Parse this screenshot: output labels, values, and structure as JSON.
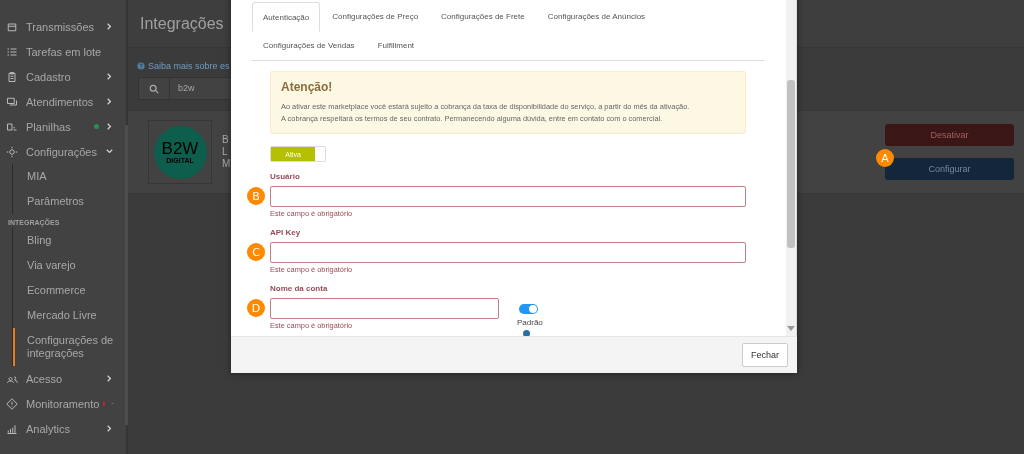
{
  "sidebar": {
    "items": [
      {
        "label": "Transmissões",
        "expanded": false
      },
      {
        "label": "Tarefas em lote"
      },
      {
        "label": "Cadastro",
        "expanded": false
      },
      {
        "label": "Atendimentos",
        "expanded": false
      },
      {
        "label": "Planilhas",
        "expanded": false,
        "color": "#2e8b57"
      },
      {
        "label": "Configurações",
        "expanded": true,
        "children": [
          {
            "label": "MIA",
            "selected": false
          },
          {
            "label": "Parâmetros",
            "selected": false
          }
        ],
        "section": {
          "title": "INTEGRAÇÕES",
          "children": [
            {
              "label": "Bling",
              "selected": false
            },
            {
              "label": "Via varejo",
              "selected": false
            },
            {
              "label": "Ecommerce",
              "selected": false
            },
            {
              "label": "Mercado Livre",
              "selected": false
            },
            {
              "label": "Configurações de integrações",
              "selected": true
            }
          ]
        }
      },
      {
        "label": "Acesso",
        "expanded": false
      },
      {
        "label": "Monitoramento",
        "expanded": false,
        "color": "#c0262d"
      },
      {
        "label": "Analytics",
        "expanded": false
      }
    ]
  },
  "page": {
    "title": "Integrações",
    "help_link": "Saiba mais sobre es",
    "search": {
      "value": "b2w"
    },
    "integration": {
      "logo_main": "B2W",
      "logo_sub": "DIGITAL",
      "info_lines": [
        "B",
        "L",
        "M"
      ],
      "buttons": [
        {
          "label": "Desativar",
          "kind": "danger"
        },
        {
          "label": "Configurar",
          "kind": "primary",
          "callout": "A"
        }
      ]
    }
  },
  "modal": {
    "tabs": [
      {
        "label": "Autenticação",
        "selected": true
      },
      {
        "label": "Configurações de Preço",
        "selected": false
      },
      {
        "label": "Configurações de Frete",
        "selected": false
      },
      {
        "label": "Configurações de Anúncios",
        "selected": false
      },
      {
        "label": "Configurações de Vendas",
        "selected": false
      },
      {
        "label": "Fulfillment",
        "selected": false
      }
    ],
    "alert": {
      "title": "Atenção!",
      "lines": [
        "Ao ativar este marketplace você estará sujeito a cobrança da taxa de disponibilidade do serviço, a partir do mês da ativação.",
        "A cobrança respeitará os termos de seu contrato. Permanecendo alguma dúvida, entre em contato com o comercial."
      ]
    },
    "status_toggle": {
      "label": "Ativa",
      "on": true
    },
    "fields": [
      {
        "label": "Usuário",
        "error": "Este campo é obrigatório",
        "callout": "B",
        "kind": "full"
      },
      {
        "label": "API Key",
        "error": "Este campo é obrigatório",
        "callout": "C",
        "kind": "full"
      },
      {
        "label": "Nome da conta",
        "error": "Este campo é obrigatório",
        "callout": "D",
        "kind": "half",
        "switch": {
          "label": "Padrão",
          "on": true
        }
      }
    ],
    "footer_button": "Fechar"
  }
}
